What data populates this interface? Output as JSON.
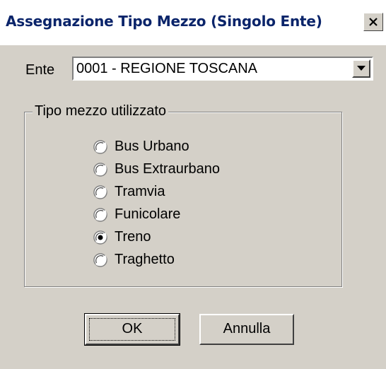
{
  "window": {
    "title": "Assegnazione Tipo Mezzo (Singolo Ente)",
    "close_icon": "close-icon"
  },
  "ente": {
    "label": "Ente",
    "selected_value": "0001 - REGIONE TOSCANA",
    "dropdown_icon": "chevron-down-icon"
  },
  "group": {
    "legend": "Tipo mezzo utilizzato",
    "options": [
      {
        "label": "Bus Urbano",
        "checked": false
      },
      {
        "label": "Bus Extraurbano",
        "checked": false
      },
      {
        "label": "Tramvia",
        "checked": false
      },
      {
        "label": "Funicolare",
        "checked": false
      },
      {
        "label": "Treno",
        "checked": true
      },
      {
        "label": "Traghetto",
        "checked": false
      }
    ]
  },
  "buttons": {
    "ok_label": "OK",
    "cancel_label": "Annulla"
  }
}
